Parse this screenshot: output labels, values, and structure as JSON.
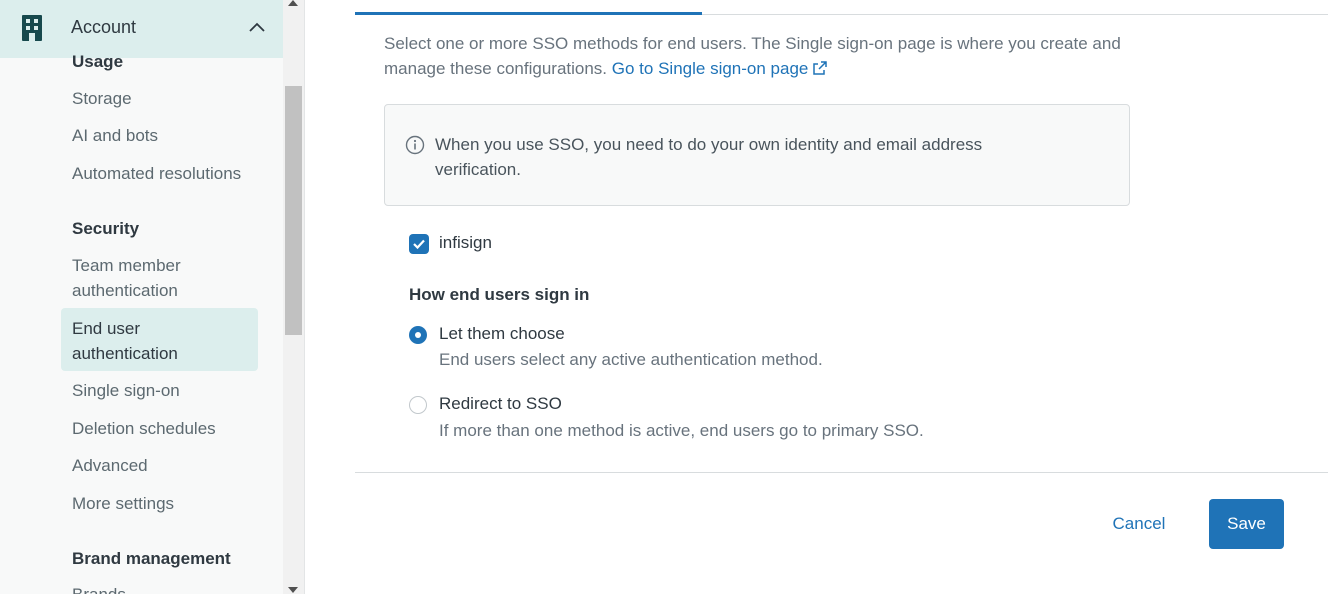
{
  "sidebar": {
    "header_title": "Account",
    "sections": [
      {
        "heading": "Usage",
        "items": [
          "Storage",
          "AI and bots",
          "Automated resolutions"
        ]
      },
      {
        "heading": "Security",
        "items": [
          "Team member authentication",
          "End user authentication",
          "Single sign-on",
          "Deletion schedules",
          "Advanced",
          "More settings"
        ]
      },
      {
        "heading": "Brand management",
        "items": [
          "Brands"
        ]
      }
    ],
    "active_item": "End user authentication"
  },
  "main": {
    "description_text": "Select one or more SSO methods for end users. The Single sign-on page is where you create and manage these configurations.",
    "description_link": "Go to Single sign-on page",
    "notice": "When you use SSO, you need to do your own identity and email address verification.",
    "sso_option": {
      "label": "infisign",
      "checked": true
    },
    "sign_in_heading": "How end users sign in",
    "radios": [
      {
        "label": "Let them choose",
        "hint": "End users select any active authentication method.",
        "selected": true
      },
      {
        "label": "Redirect to SSO",
        "hint": "If more than one method is active, end users go to primary SSO.",
        "selected": false
      }
    ],
    "cancel_label": "Cancel",
    "save_label": "Save"
  },
  "colors": {
    "accent": "#1f73b7",
    "sidebar_active": "#dceeed",
    "sidebar_bg": "#f8f9f9"
  },
  "icons": {
    "header": "building-icon",
    "collapse": "chevron-up-icon",
    "notice": "info-icon",
    "link": "external-link-icon",
    "checkbox": "check-icon"
  }
}
